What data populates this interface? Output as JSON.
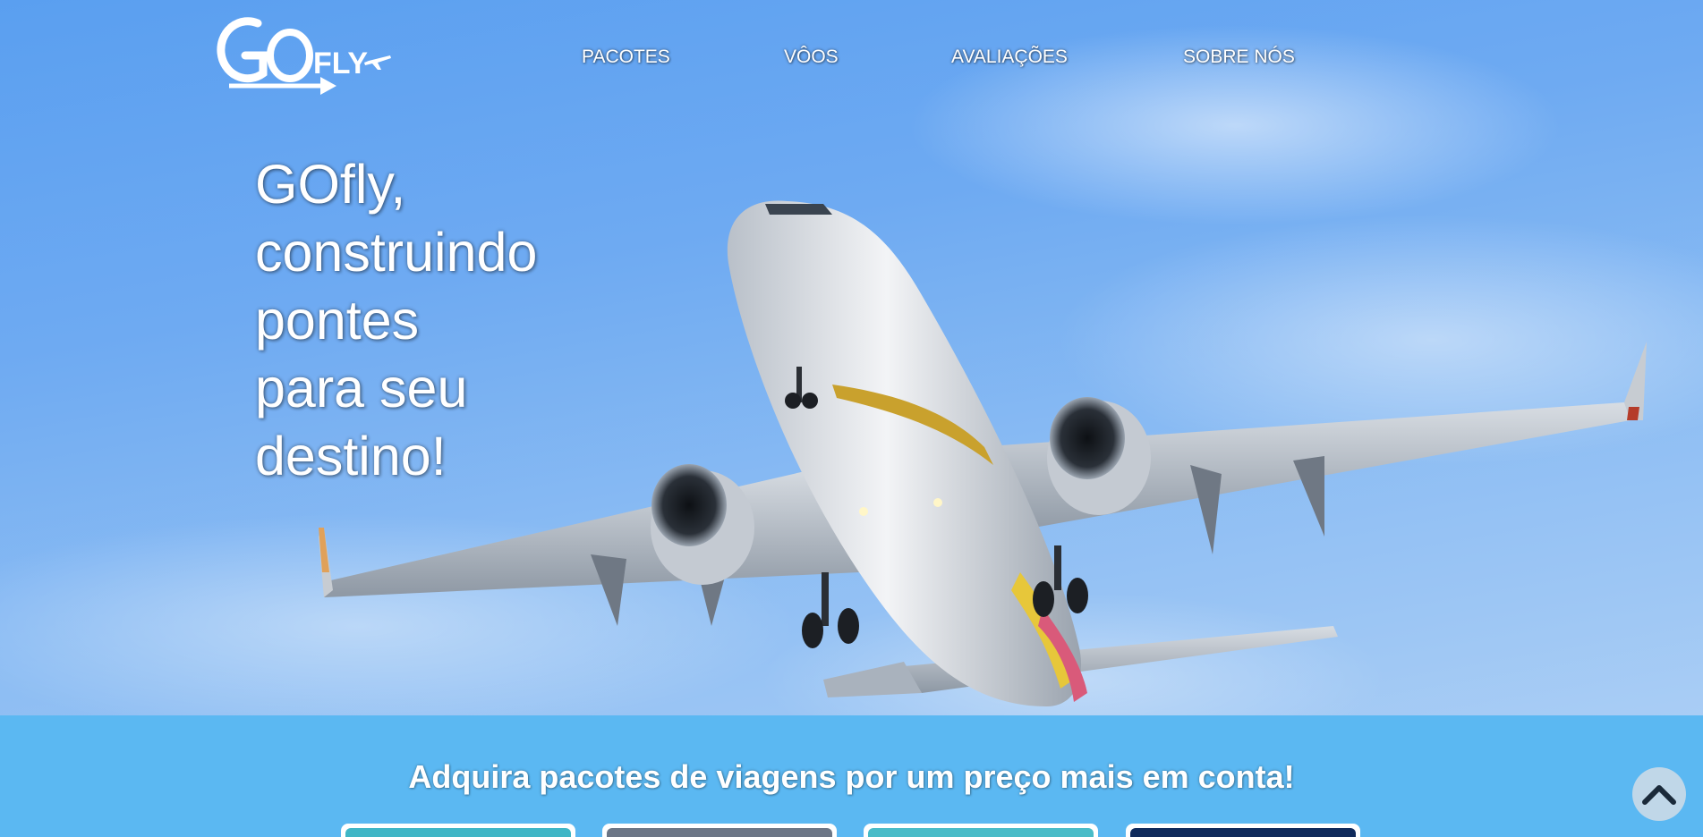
{
  "brand": {
    "logo_text": "GOfly"
  },
  "nav": {
    "items": [
      {
        "label": "PACOTES"
      },
      {
        "label": "VÔOS"
      },
      {
        "label": "AVALIAÇÕES"
      },
      {
        "label": "SOBRE NÓS"
      }
    ]
  },
  "hero": {
    "headline_lines": [
      "GOfly,",
      "construindo",
      "pontes",
      "para seu",
      "destino!"
    ]
  },
  "packages": {
    "title": "Adquira pacotes de viagens por um preço mais em conta!",
    "cards": [
      {
        "color": "#3fb6c6"
      },
      {
        "color": "#6c7686"
      },
      {
        "color": "#49bcc8"
      },
      {
        "color": "#0f2a5c"
      }
    ]
  },
  "back_to_top": {
    "icon": "chevron-up-icon"
  },
  "colors": {
    "section_bg": "#5bb8f2",
    "sky": "#6eaaf2",
    "text": "#ffffff"
  }
}
